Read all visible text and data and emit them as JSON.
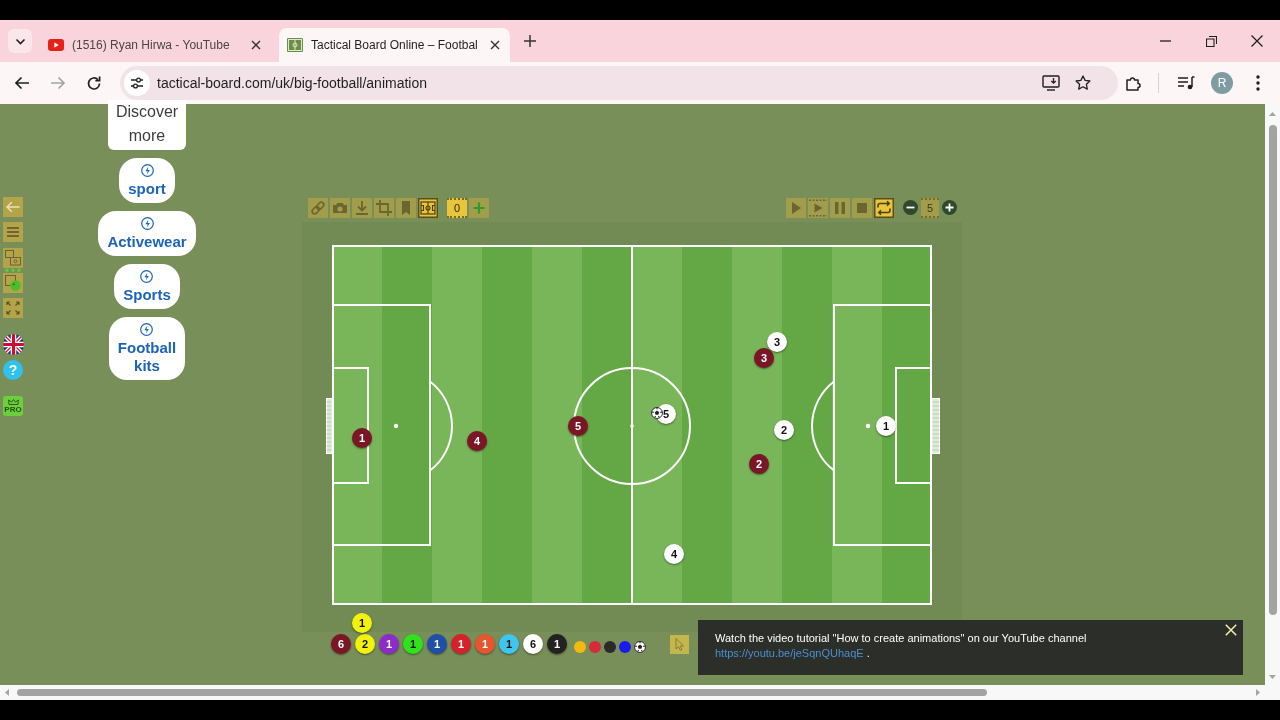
{
  "browser": {
    "tabs": [
      {
        "kind": "video",
        "title": "(1516) Ryan Hirwa - YouTube",
        "selected": false
      },
      {
        "kind": "board",
        "title": "Tactical Board Online – Footbal",
        "selected": true
      }
    ],
    "nav": [
      {
        "kind": "back",
        "disabled": false
      },
      {
        "kind": "forward",
        "disabled": true
      },
      {
        "kind": "reload",
        "disabled": false
      }
    ],
    "address": "tactical-board.com/uk/big-football/animation",
    "profile": "R"
  },
  "side_tools": {
    "help": "?",
    "pro": "PRO"
  },
  "ads": {
    "discover": "Discover more",
    "links": [
      "sport",
      "Activewear",
      "Sports",
      "Football kits"
    ]
  },
  "board_toolbar": {
    "tools": [
      {
        "kind": "link",
        "on": false
      },
      {
        "kind": "camera",
        "on": false
      },
      {
        "kind": "download",
        "on": false
      },
      {
        "kind": "crop",
        "on": false
      },
      {
        "kind": "bookmark",
        "on": false
      },
      {
        "kind": "pitch",
        "on": true
      }
    ],
    "frame": "0",
    "playback": [
      {
        "kind": "play",
        "on": false
      },
      {
        "kind": "step",
        "on": false
      },
      {
        "kind": "pause",
        "on": false
      },
      {
        "kind": "stop",
        "on": false
      },
      {
        "kind": "loop",
        "on": true
      }
    ],
    "speed": "5"
  },
  "pitch": {
    "players": [
      {
        "number": "1",
        "color": "#7b1626"
      },
      {
        "number": "4",
        "color": "#7b1626"
      },
      {
        "number": "5",
        "color": "#7b1626"
      },
      {
        "number": "3",
        "color": "#7b1626"
      },
      {
        "number": "2",
        "color": "#7b1626"
      },
      {
        "number": "5",
        "color": "#ffffff"
      },
      {
        "number": "3",
        "color": "#ffffff"
      },
      {
        "number": "2",
        "color": "#ffffff"
      },
      {
        "number": "1",
        "color": "#ffffff"
      },
      {
        "number": "4",
        "color": "#ffffff"
      }
    ]
  },
  "palette": {
    "raised": {
      "number": "1",
      "color": "#f2f20c"
    },
    "tokens": [
      {
        "number": "6",
        "color": "#7b1626"
      },
      {
        "number": "2",
        "color": "#f2f20c"
      },
      {
        "number": "1",
        "color": "#8e2bc9"
      },
      {
        "number": "1",
        "color": "#2ee31c"
      },
      {
        "number": "1",
        "color": "#1f4fa8"
      },
      {
        "number": "1",
        "color": "#d8202a"
      },
      {
        "number": "1",
        "color": "#e5562e"
      },
      {
        "number": "1",
        "color": "#3fc6ee"
      },
      {
        "number": "6",
        "color": "#ffffff"
      },
      {
        "number": "1",
        "color": "#222222"
      }
    ],
    "dots": [
      {
        "color": "#f2b90f"
      },
      {
        "color": "#d42a3a"
      },
      {
        "color": "#2a2a2a"
      },
      {
        "color": "#1a1aee"
      }
    ]
  },
  "toast": {
    "message": "Watch the video tutorial \"How to create animations\" on our YouTube channel",
    "link": "https://youtu.be/jeSqnQUhaqE",
    "suffix": "."
  }
}
